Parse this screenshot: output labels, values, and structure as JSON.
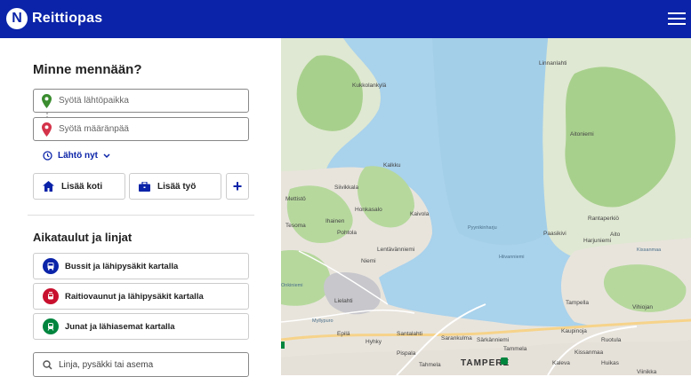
{
  "app": {
    "title": "Reittiopas",
    "logo_letter": "N",
    "brand_color": "#0a23a8"
  },
  "search": {
    "heading": "Minne mennään?",
    "origin_placeholder": "Syötä lähtöpaikka",
    "destination_placeholder": "Syötä määränpää",
    "time_label": "Lähtö nyt"
  },
  "favourites": {
    "home_label": "Lisää koti",
    "work_label": "Lisää työ",
    "add_symbol": "+"
  },
  "timetables": {
    "heading": "Aikataulut ja linjat",
    "items": [
      {
        "label": "Bussit ja lähipysäkit kartalla",
        "icon": "bus-icon",
        "color": "#0a23a8"
      },
      {
        "label": "Raitiovaunut ja lähipysäkit kartalla",
        "icon": "tram-icon",
        "color": "#c8102e"
      },
      {
        "label": "Junat ja lähiasemat kartalla",
        "icon": "train-icon",
        "color": "#00853e"
      }
    ],
    "stop_search_placeholder": "Linja, pysäkki tai asema"
  },
  "map": {
    "labels": [
      "Kukkolankylä",
      "Linnanlahti",
      "Aitoniemi",
      "Kalkku",
      "Siivikkala",
      "Mettistö",
      "Honkasalo",
      "Kaivola",
      "Ihainen",
      "Pohtola",
      "Tesoma",
      "Lentävänniemi",
      "Tahmela",
      "Ruotula",
      "Niemi",
      "Lielahti",
      "Epilä",
      "Hyhky",
      "Santalahti",
      "Sarankulma",
      "Särkänniemi",
      "Tammela",
      "Pispala",
      "Kaleva",
      "Kaupinoja",
      "Kissanmaa",
      "Huikas",
      "Viinikka",
      "Tampella",
      "Vihiojan",
      "Rantaperkiö",
      "Harjuniemi",
      "Paasikivi",
      "Aito"
    ],
    "city_label": "TAMPERE",
    "small_labels": [
      "Pyynikinharju",
      "Hiivanniemi",
      "Myllypuro",
      "Kissanmaa",
      "Onkiniemi"
    ]
  }
}
